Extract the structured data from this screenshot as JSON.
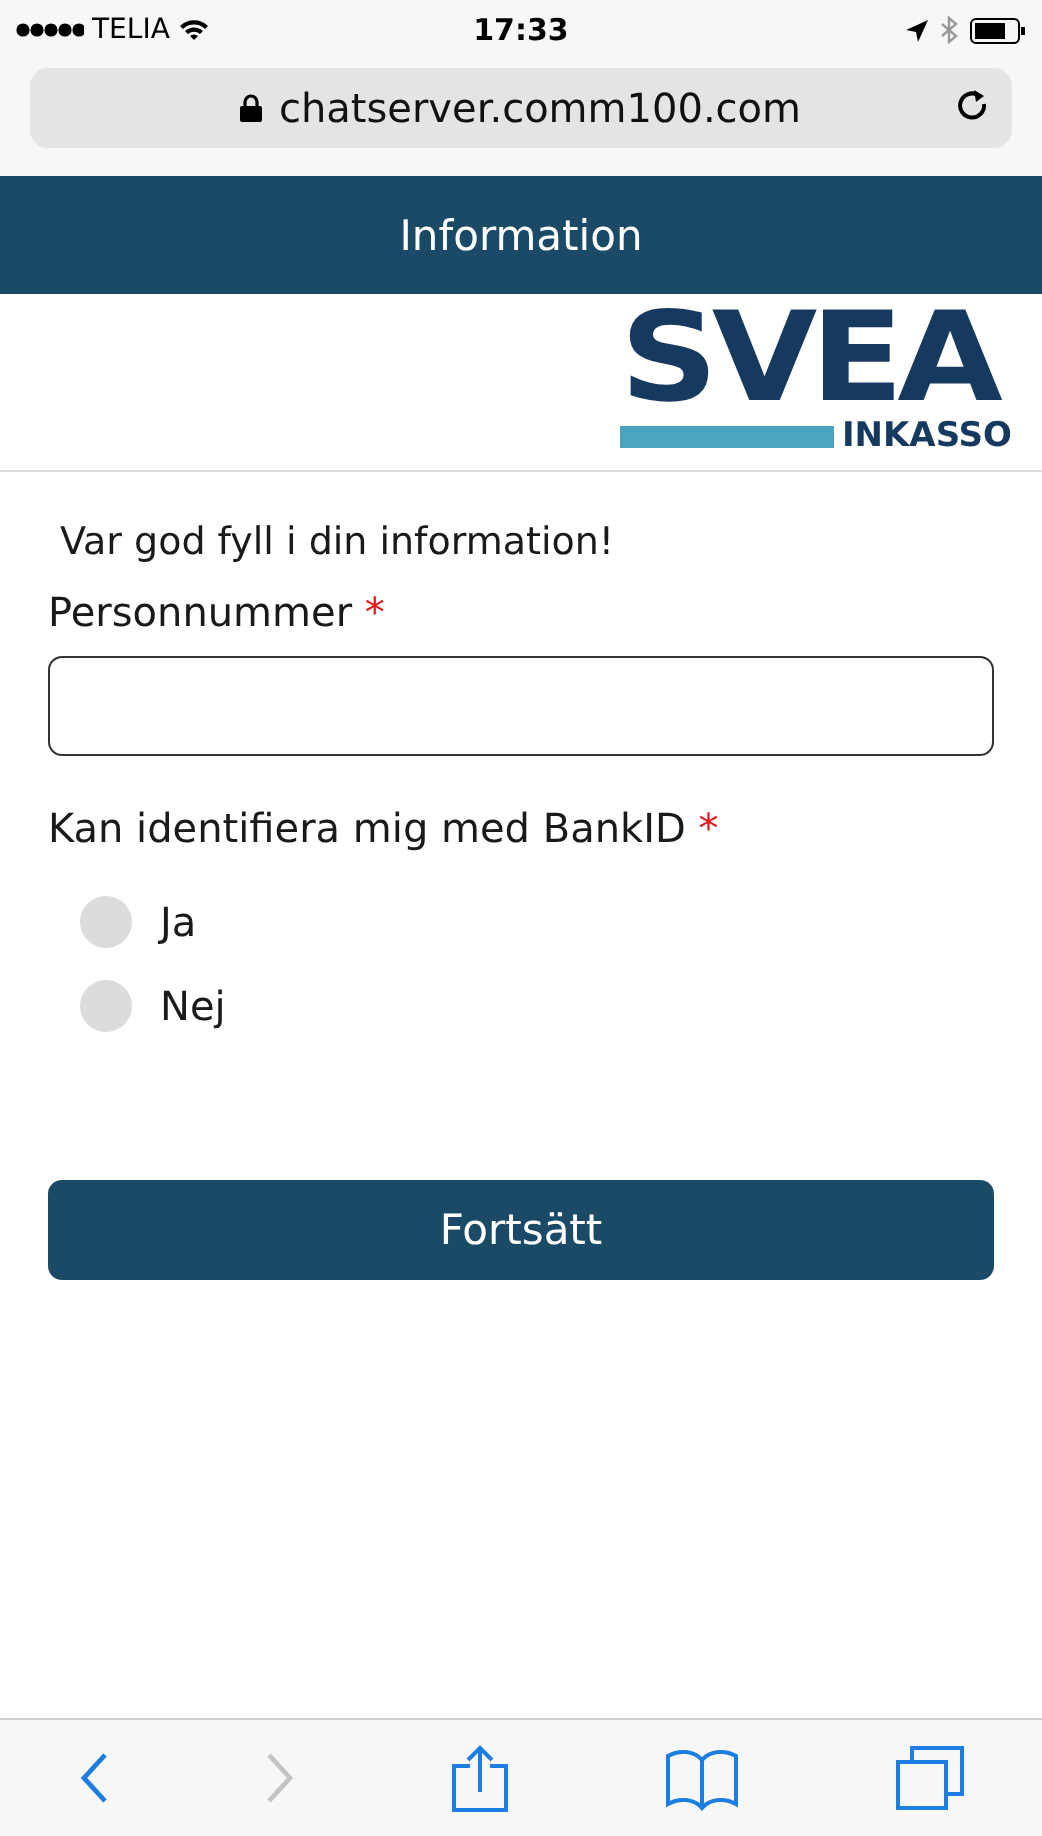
{
  "status_bar": {
    "carrier": "TELIA",
    "time": "17:33"
  },
  "address_bar": {
    "url": "chatserver.comm100.com",
    "secure": true
  },
  "header": {
    "title": "Information"
  },
  "logo": {
    "name": "SVEA",
    "subtitle": "INKASSO"
  },
  "form": {
    "intro": "Var god fyll i din information!",
    "fields": [
      {
        "kind": "text",
        "label": "Personnummer",
        "required_mark": "*"
      },
      {
        "kind": "radio",
        "label": "Kan identifiera mig med BankID",
        "required_mark": "*",
        "options": [
          {
            "label": "Ja",
            "selected": false
          },
          {
            "label": "Nej",
            "selected": false
          }
        ]
      }
    ],
    "submit": "Fortsätt"
  },
  "toolbar": [
    {
      "kind": "back",
      "disabled": false
    },
    {
      "kind": "forward",
      "disabled": true
    },
    {
      "kind": "share",
      "disabled": false
    },
    {
      "kind": "bookmarks",
      "disabled": false
    },
    {
      "kind": "tabs",
      "disabled": false
    }
  ]
}
